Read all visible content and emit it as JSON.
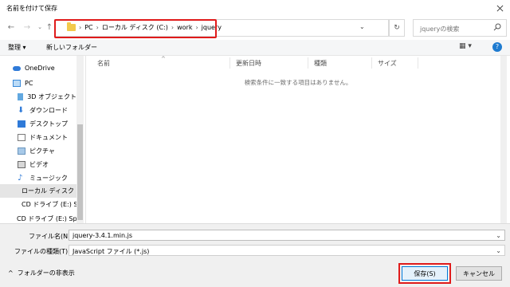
{
  "window": {
    "title": "名前を付けて保存"
  },
  "address": {
    "crumbs": [
      "PC",
      "ローカル ディスク (C:)",
      "work",
      "jquery"
    ]
  },
  "search": {
    "placeholder": "jqueryの検索"
  },
  "toolbar": {
    "organize": "整理",
    "new_folder": "新しいフォルダー"
  },
  "sidebar": {
    "items": [
      {
        "label": "OneDrive",
        "icon": "cloud-icon"
      },
      {
        "label": "PC",
        "icon": "pc-icon"
      },
      {
        "label": "3D オブジェクト",
        "icon": "cube-icon"
      },
      {
        "label": "ダウンロード",
        "icon": "download-icon"
      },
      {
        "label": "デスクトップ",
        "icon": "desktop-icon"
      },
      {
        "label": "ドキュメント",
        "icon": "document-icon"
      },
      {
        "label": "ピクチャ",
        "icon": "picture-icon"
      },
      {
        "label": "ビデオ",
        "icon": "video-icon"
      },
      {
        "label": "ミュージック",
        "icon": "music-icon"
      },
      {
        "label": "ローカル ディスク (C",
        "icon": "disk-icon",
        "selected": true
      },
      {
        "label": "CD ドライブ (E:) Sp",
        "icon": "cd-drive-icon"
      },
      {
        "label": "CD ドライブ (E:) Spe",
        "icon": "cd-drive-icon"
      }
    ]
  },
  "main": {
    "columns": [
      "名前",
      "更新日時",
      "種類",
      "サイズ"
    ],
    "empty_message": "検索条件に一致する項目はありません。"
  },
  "form": {
    "filename_label": "ファイル名(N):",
    "filename_value": "jquery-3.4.1.min.js",
    "filetype_label": "ファイルの種類(T):",
    "filetype_value": "JavaScript ファイル (*.js)"
  },
  "footer": {
    "hide_folders": "フォルダーの非表示",
    "save": "保存(S)",
    "cancel": "キャンセル"
  },
  "colors": {
    "highlight": "#e01b1b",
    "accent": "#0078d7"
  }
}
